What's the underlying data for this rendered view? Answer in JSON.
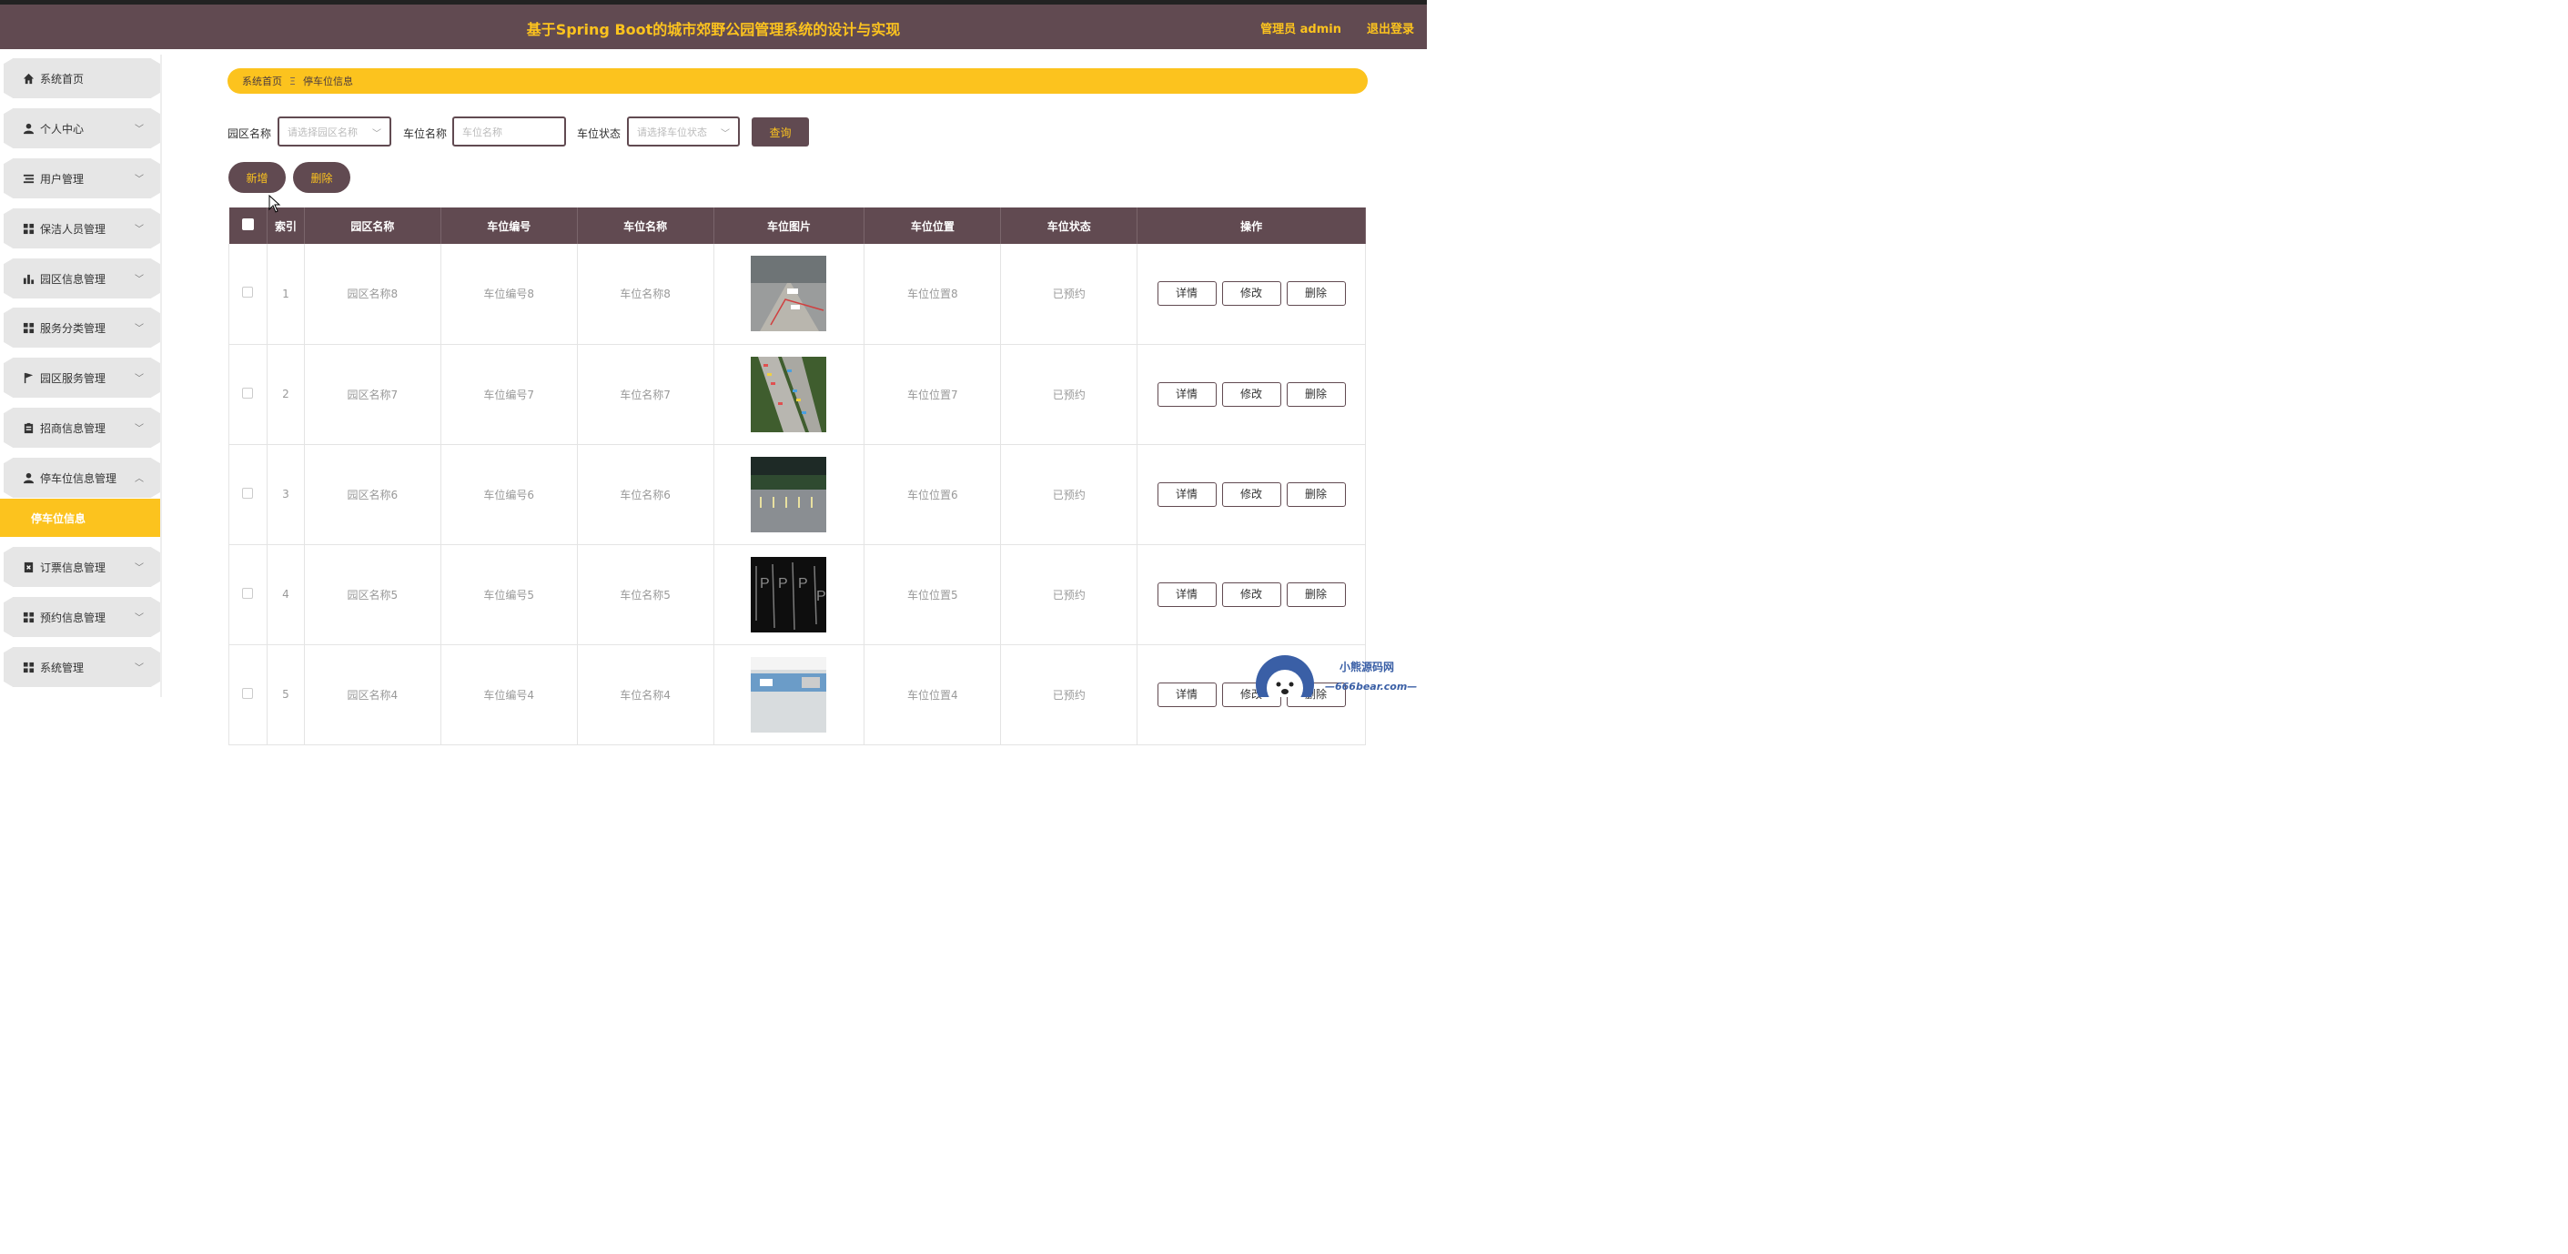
{
  "header": {
    "title": "基于Spring Boot的城市郊野公园管理系统的设计与实现",
    "user": "管理员 admin",
    "logout": "退出登录"
  },
  "sidebar": {
    "items": [
      {
        "label": "系统首页",
        "icon": "home-icon"
      },
      {
        "label": "个人中心",
        "icon": "user-icon"
      },
      {
        "label": "用户管理",
        "icon": "list-icon"
      },
      {
        "label": "保洁人员管理",
        "icon": "grid-icon"
      },
      {
        "label": "园区信息管理",
        "icon": "bar-chart-icon"
      },
      {
        "label": "服务分类管理",
        "icon": "grid-icon"
      },
      {
        "label": "园区服务管理",
        "icon": "flag-icon"
      },
      {
        "label": "招商信息管理",
        "icon": "clipboard-icon"
      },
      {
        "label": "停车位信息管理",
        "icon": "user-icon"
      },
      {
        "label": "订票信息管理",
        "icon": "ticket-icon"
      },
      {
        "label": "预约信息管理",
        "icon": "grid-icon"
      },
      {
        "label": "系统管理",
        "icon": "grid-icon"
      }
    ],
    "active_sub": "停车位信息"
  },
  "breadcrumb": {
    "home": "系统首页",
    "separator": "Ξ",
    "current": "停车位信息"
  },
  "search": {
    "park_label": "园区名称",
    "park_placeholder": "请选择园区名称",
    "spot_label": "车位名称",
    "spot_placeholder": "车位名称",
    "status_label": "车位状态",
    "status_placeholder": "请选择车位状态",
    "query_button": "查询"
  },
  "actions": {
    "add": "新增",
    "delete": "删除"
  },
  "table": {
    "headers": [
      "索引",
      "园区名称",
      "车位编号",
      "车位名称",
      "车位图片",
      "车位位置",
      "车位状态",
      "操作"
    ],
    "row_buttons": {
      "detail": "详情",
      "edit": "修改",
      "delete": "删除"
    },
    "rows": [
      {
        "index": "1",
        "park": "园区名称8",
        "code": "车位编号8",
        "name": "车位名称8",
        "location": "车位位置8",
        "status": "已预约"
      },
      {
        "index": "2",
        "park": "园区名称7",
        "code": "车位编号7",
        "name": "车位名称7",
        "location": "车位位置7",
        "status": "已预约"
      },
      {
        "index": "3",
        "park": "园区名称6",
        "code": "车位编号6",
        "name": "车位名称6",
        "location": "车位位置6",
        "status": "已预约"
      },
      {
        "index": "4",
        "park": "园区名称5",
        "code": "车位编号5",
        "name": "车位名称5",
        "location": "车位位置5",
        "status": "已预约"
      },
      {
        "index": "5",
        "park": "园区名称4",
        "code": "车位编号4",
        "name": "车位名称4",
        "location": "车位位置4",
        "status": "已预约"
      }
    ]
  },
  "watermark": {
    "line1": "小熊源码网",
    "line2": "—666bear.com—"
  },
  "colors": {
    "primary": "#614a51",
    "accent": "#fcc31e"
  }
}
